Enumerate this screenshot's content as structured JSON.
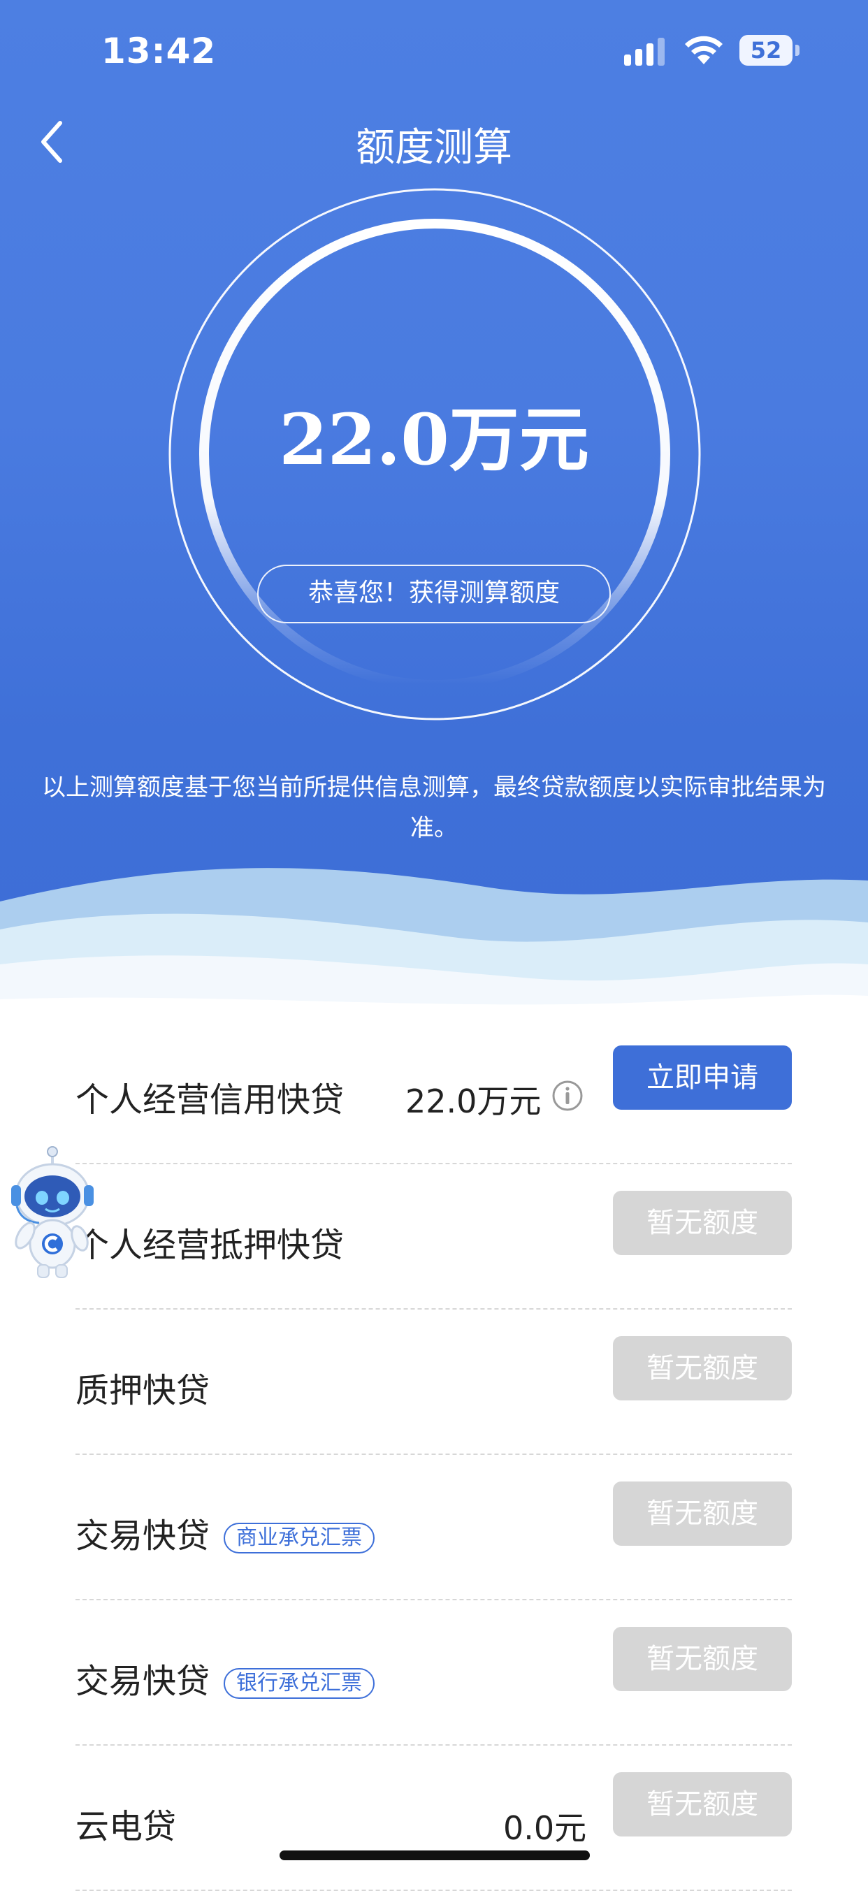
{
  "status_bar": {
    "time": "13:42",
    "battery": "52"
  },
  "header": {
    "title": "额度测算"
  },
  "result": {
    "amount": "22.0万元",
    "congrats": "恭喜您！获得测算额度",
    "notice": "以上测算额度基于您当前所提供信息测算，最终贷款额度以实际审批结果为准。"
  },
  "loans": [
    {
      "name": "个人经营信用快贷",
      "tag": "",
      "amount": "22.0万元",
      "button": "立即申请",
      "enabled": true
    },
    {
      "name": "个人经营抵押快贷",
      "tag": "",
      "amount": "",
      "button": "暂无额度",
      "enabled": false
    },
    {
      "name": "质押快贷",
      "tag": "",
      "amount": "",
      "button": "暂无额度",
      "enabled": false
    },
    {
      "name": "交易快贷",
      "tag": "商业承兑汇票",
      "amount": "",
      "button": "暂无额度",
      "enabled": false
    },
    {
      "name": "交易快贷",
      "tag": "银行承兑汇票",
      "amount": "",
      "button": "暂无额度",
      "enabled": false
    },
    {
      "name": "云电贷",
      "tag": "",
      "amount": "0.0元",
      "button": "暂无额度",
      "enabled": false
    }
  ],
  "icons": {
    "back": "chevron-left-icon",
    "info": "info-circle-icon",
    "assistant": "robot-assistant-icon"
  },
  "colors": {
    "primary": "#3e6fd8",
    "disabled": "#d6d6d6",
    "tag": "#3d6fd9"
  }
}
